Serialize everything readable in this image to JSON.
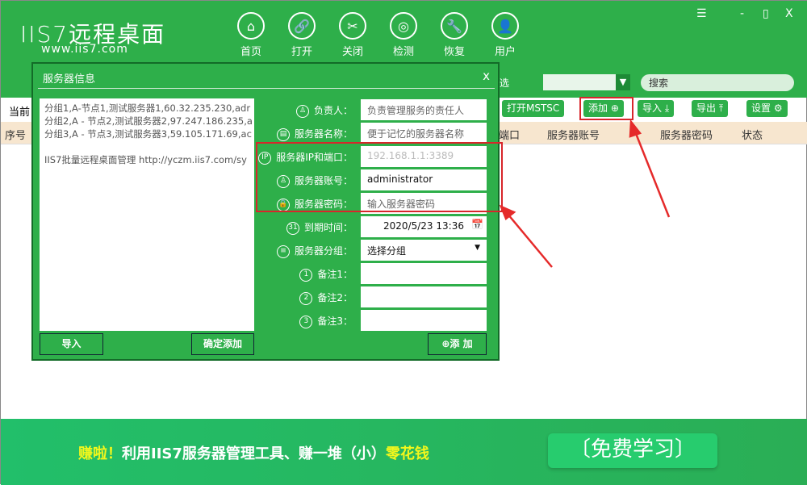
{
  "app": {
    "logo": "IIS7远程桌面",
    "site": "www.iis7.com"
  },
  "nav": [
    {
      "label": "首页",
      "icon": "home-icon",
      "g": "⌂"
    },
    {
      "label": "打开",
      "icon": "link-icon",
      "g": "🔗"
    },
    {
      "label": "关闭",
      "icon": "unlink-icon",
      "g": "✂"
    },
    {
      "label": "检测",
      "icon": "radar-icon",
      "g": "◎"
    },
    {
      "label": "恢复",
      "icon": "wrench-icon",
      "g": "🔧"
    },
    {
      "label": "用户",
      "icon": "user-icon",
      "g": "👤"
    }
  ],
  "window": {
    "menu": "☰",
    "min": "-",
    "max": "▯",
    "close": "X"
  },
  "tabrow": {
    "filter": "选",
    "search_placeholder": "搜索"
  },
  "toolbar": {
    "current": "当前",
    "mstsc": "打开MSTSC",
    "add": "添加 ⊕",
    "import": "导入 ⤓",
    "export": "导出 ⤒",
    "settings": "设置 ⚙"
  },
  "table": {
    "headers": [
      "序号",
      "端口",
      "服务器账号",
      "服务器密码",
      "状态"
    ]
  },
  "dialog": {
    "title": "服务器信息",
    "close": "x",
    "batch_text": [
      "分组1,A-节点1,测试服务器1,60.32.235.230,adr",
      "分组2,A - 节点2,测试服务器2,97.247.186.235,a",
      "分组3,A - 节点3,测试服务器3,59.105.171.69,ac",
      "",
      "IIS7批量远程桌面管理 http://yczm.iis7.com/sy"
    ],
    "fields": [
      {
        "label": "负责人：",
        "icon": "user-icon",
        "g": "♙",
        "value": "负责管理服务的责任人",
        "placeholder": true
      },
      {
        "label": "服务器名称：",
        "icon": "id-card-icon",
        "g": "▤",
        "value": "便于记忆的服务器名称",
        "placeholder": true
      },
      {
        "label": "服务器IP和端口：",
        "icon": "ip-icon",
        "g": "IP",
        "value": "192.168.1.1:3389",
        "placeholder": true
      },
      {
        "label": "服务器账号：",
        "icon": "user-icon",
        "g": "♙",
        "value": "administrator",
        "placeholder": false
      },
      {
        "label": "服务器密码：",
        "icon": "lock-icon",
        "g": "🔒",
        "value": "输入服务器密码",
        "placeholder": true
      },
      {
        "label": "到期时间：",
        "icon": "calendar-icon",
        "g": "31",
        "value": "2020/5/23 13:36",
        "placeholder": false
      },
      {
        "label": "服务器分组：",
        "icon": "list-icon",
        "g": "≡",
        "value": "选择分组",
        "placeholder": false
      },
      {
        "label": "备注1：",
        "icon": "number-1-icon",
        "g": "1",
        "value": "",
        "placeholder": false
      },
      {
        "label": "备注2：",
        "icon": "number-2-icon",
        "g": "2",
        "value": "",
        "placeholder": false
      },
      {
        "label": "备注3：",
        "icon": "number-3-icon",
        "g": "3",
        "value": "",
        "placeholder": false
      }
    ],
    "import": "导入",
    "confirm_add": "确定添加",
    "add": "⊕添 加"
  },
  "banner": {
    "lead": "赚啦！",
    "mid": "利用IIS7服务器管理工具、赚一堆（小）",
    "tail": "零花钱",
    "cta": "〔免费学习〕"
  },
  "colors": {
    "green": "#2eaf4a",
    "highlight": "#d8262b",
    "yellow": "#f3f71c"
  }
}
